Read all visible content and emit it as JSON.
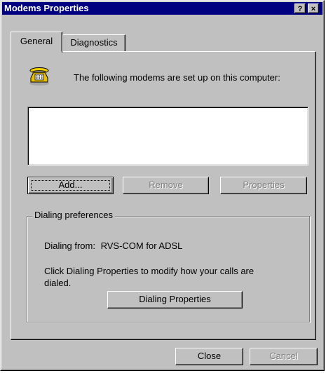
{
  "window": {
    "title": "Modems Properties",
    "help_button": "?",
    "close_button": "×"
  },
  "tabs": [
    {
      "label": "General",
      "active": true
    },
    {
      "label": "Diagnostics",
      "active": false
    }
  ],
  "general": {
    "icon": "phone-icon",
    "intro": "The following modems are set up on this computer:",
    "modems": [],
    "buttons": {
      "add": "Add...",
      "remove": "Remove",
      "properties": "Properties"
    },
    "dialing": {
      "group_label": "Dialing preferences",
      "from_label": "Dialing from:",
      "from_value": "RVS-COM for ADSL",
      "info_line1": "Click Dialing Properties to modify how your calls are",
      "info_line2": "dialed.",
      "button": "Dialing Properties"
    }
  },
  "footer": {
    "close": "Close",
    "cancel": "Cancel"
  }
}
